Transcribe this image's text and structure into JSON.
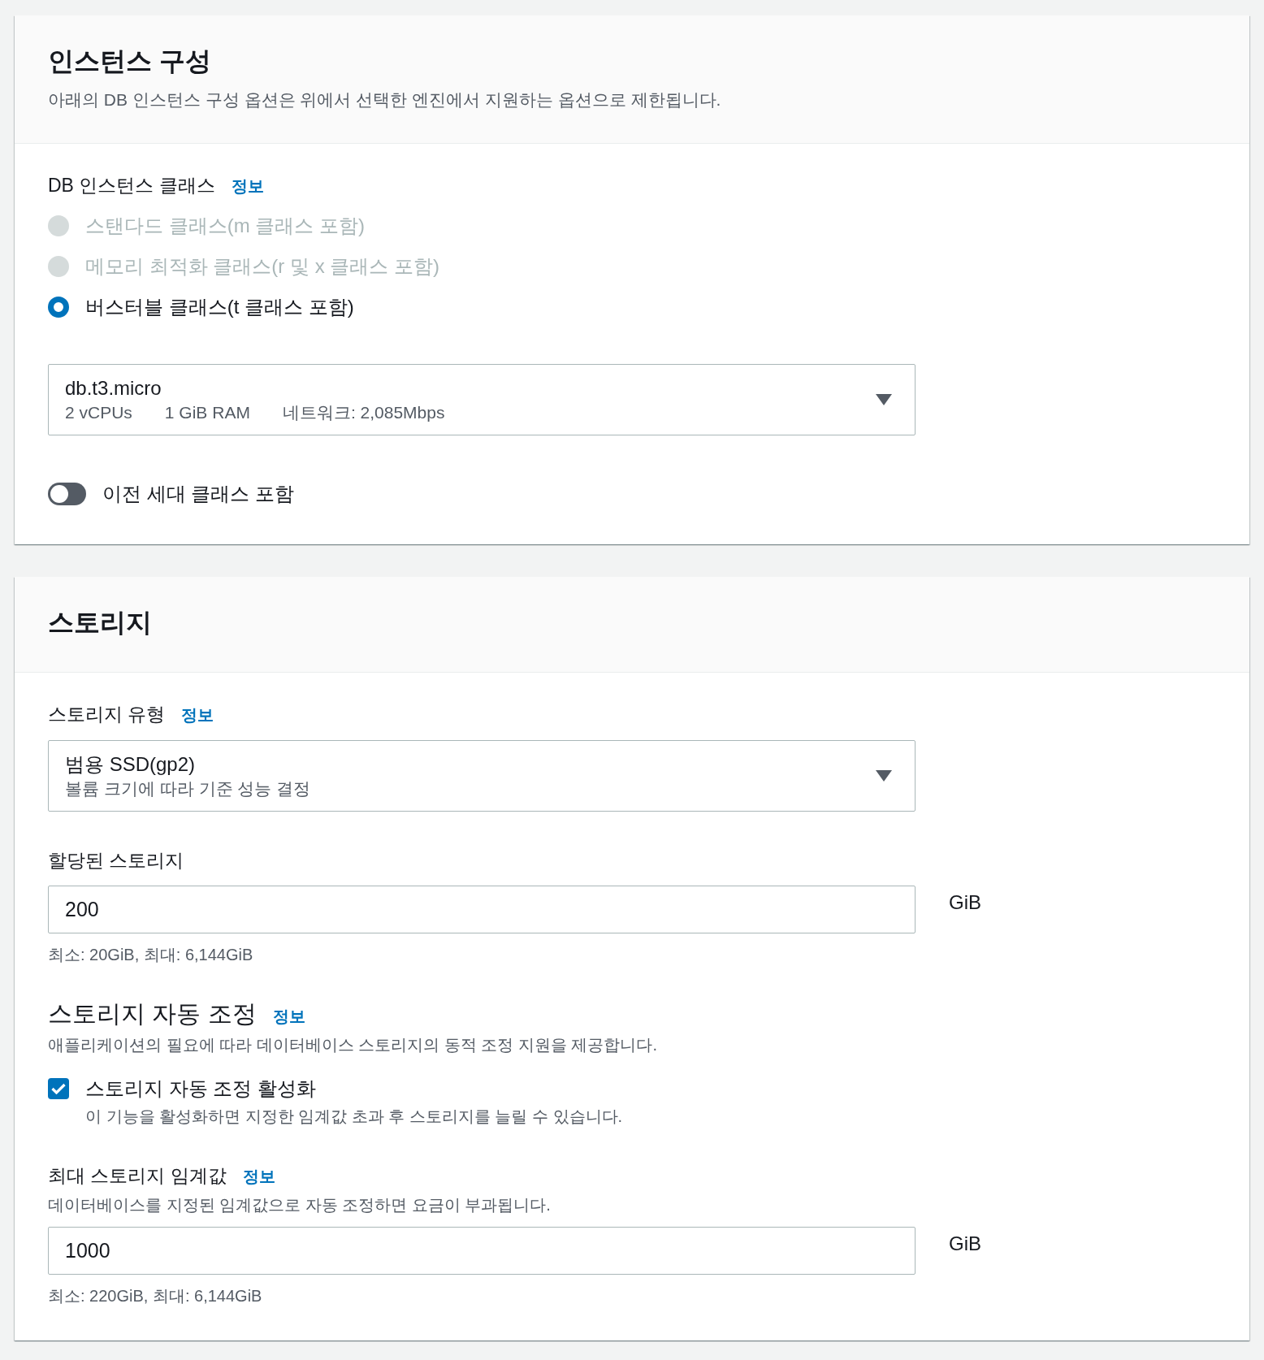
{
  "panels": [
    {
      "title": "인스턴스 구성",
      "description": "아래의 DB 인스턴스 구성 옵션은 위에서 선택한 엔진에서 지원하는 옵션으로 제한됩니다.",
      "fields": [
        {
          "kind": "radio_group",
          "label": "DB 인스턴스 클래스",
          "info_link": "정보",
          "options": [
            {
              "label": "스탠다드 클래스(m 클래스 포함)",
              "selected": false,
              "disabled": true
            },
            {
              "label": "메모리 최적화 클래스(r 및 x 클래스 포함)",
              "selected": false,
              "disabled": true
            },
            {
              "label": "버스터블 클래스(t 클래스 포함)",
              "selected": true,
              "disabled": false
            }
          ]
        },
        {
          "kind": "select",
          "value": "db.t3.micro",
          "details": [
            "2 vCPUs",
            "1 GiB RAM",
            "네트워크: 2,085Mbps"
          ]
        },
        {
          "kind": "toggle",
          "label": "이전 세대 클래스 포함",
          "on": false
        }
      ]
    },
    {
      "title": "스토리지",
      "fields": [
        {
          "kind": "select",
          "label": "스토리지 유형",
          "info_link": "정보",
          "value": "범용 SSD(gp2)",
          "details": [
            "볼륨 크기에 따라 기준 성능 결정"
          ]
        },
        {
          "kind": "number_input",
          "label": "할당된 스토리지",
          "value": "200",
          "unit": "GiB",
          "constraint": "최소: 20GiB, 최대: 6,144GiB"
        },
        {
          "kind": "checkbox_group",
          "heading": "스토리지 자동 조정",
          "info_link": "정보",
          "description": "애플리케이션의 필요에 따라 데이터베이스 스토리지의 동적 조정 지원을 제공합니다.",
          "checkbox": {
            "label": "스토리지 자동 조정 활성화",
            "description": "이 기능을 활성화하면 지정한 임계값 초과 후 스토리지를 늘릴 수 있습니다.",
            "checked": true
          }
        },
        {
          "kind": "number_input",
          "label": "최대 스토리지 임계값",
          "info_link": "정보",
          "description": "데이터베이스를 지정된 임계값으로 자동 조정하면 요금이 부과됩니다.",
          "value": "1000",
          "unit": "GiB",
          "constraint": "최소: 220GiB, 최대: 6,144GiB"
        }
      ]
    }
  ]
}
